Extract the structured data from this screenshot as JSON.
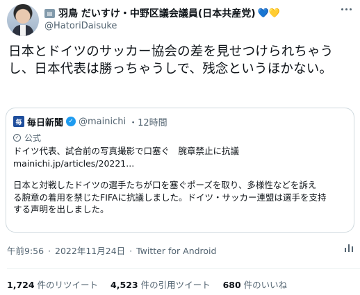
{
  "author": {
    "display_name": "羽鳥 だいすけ・中野区議会議員(日本共産党)",
    "hearts": "💙💛",
    "handle": "@HatoriDaisuke",
    "badge_icon": "government-badge-icon"
  },
  "tweet": {
    "text": "日本とドイツのサッカー協会の差を見せつけられちゃうし、日本代表は勝っちゃうしで、残念というほかない。"
  },
  "quote": {
    "source_name": "毎日新聞",
    "source_handle": "@mainichi",
    "time": "・12時間",
    "label": "公式",
    "line1": "ドイツ代表、試合前の写真撮影で口塞ぐ　腕章禁止に抗議",
    "line2": "mainichi.jp/articles/20221...",
    "line3": "日本と対戦したドイツの選手たちが口を塞ぐポーズを取り、多様性などを訴え",
    "line4": "る腕章の着用を禁じたFIFAに抗議しました。ドイツ・サッカー連盟は選手を支持",
    "line5": "する声明を出しました。"
  },
  "meta": {
    "time": "午前9:56",
    "date": "2022年11月24日",
    "client": "Twitter for Android",
    "separator": "·"
  },
  "stats": {
    "retweets_count": "1,724",
    "retweets_label": "件のリツイート",
    "quotes_count": "4,523",
    "quotes_label": "件の引用ツイート",
    "likes_count": "680",
    "likes_label": "件のいいね"
  },
  "colors": {
    "text": "#0f1419",
    "secondary": "#536471",
    "verified": "#1d9bf0",
    "border": "#cfd9de"
  }
}
